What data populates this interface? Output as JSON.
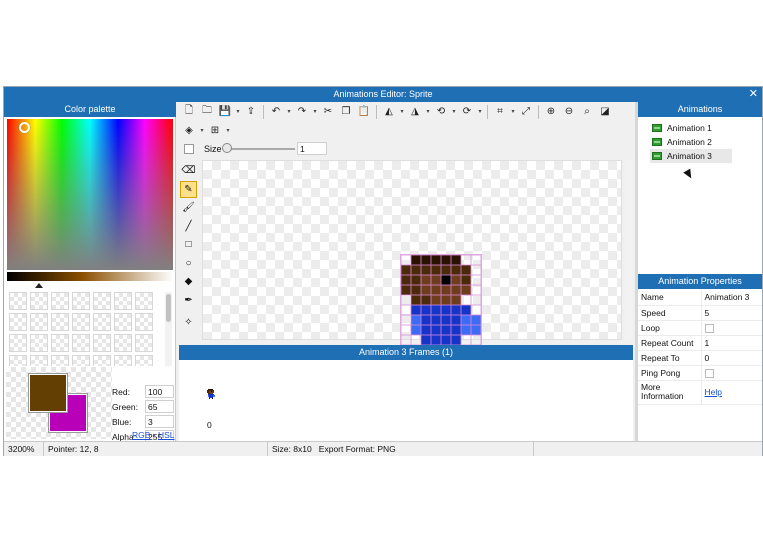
{
  "window": {
    "title": "Animations Editor: Sprite",
    "close_glyph": "✕"
  },
  "palette": {
    "header": "Color palette",
    "swatch_count": 28,
    "primary_color": "#643f03",
    "secondary_color": "#b800b8",
    "fields": [
      {
        "label": "Red:",
        "value": "100"
      },
      {
        "label": "Green:",
        "value": "65"
      },
      {
        "label": "Blue:",
        "value": "3"
      },
      {
        "label": "Alpha:",
        "value": "255"
      }
    ],
    "mode_rgb": "RGB",
    "mode_sep": " - ",
    "mode_hsl": "HSL"
  },
  "toolbar": {
    "row1": [
      {
        "name": "new-file-icon",
        "glyph": "🗋"
      },
      {
        "name": "open-folder-icon",
        "glyph": "🗀"
      },
      {
        "name": "save-icon",
        "glyph": "💾"
      },
      {
        "name": "save-dropdown-icon",
        "glyph": "▾",
        "small": true
      },
      {
        "name": "export-icon",
        "glyph": "⇪"
      },
      {
        "sep": true
      },
      {
        "name": "undo-icon",
        "glyph": "↶"
      },
      {
        "name": "undo-dropdown-icon",
        "glyph": "▾",
        "small": true
      },
      {
        "name": "redo-icon",
        "glyph": "↷"
      },
      {
        "name": "redo-dropdown-icon",
        "glyph": "▾",
        "small": true
      },
      {
        "name": "cut-icon",
        "glyph": "✂"
      },
      {
        "name": "copy-icon",
        "glyph": "❐"
      },
      {
        "name": "paste-icon",
        "glyph": "📋"
      },
      {
        "sep": true
      },
      {
        "name": "flip-horizontal-icon",
        "glyph": "◭"
      },
      {
        "name": "flip-h-dropdown-icon",
        "glyph": "▾",
        "small": true
      },
      {
        "name": "flip-vertical-icon",
        "glyph": "◮"
      },
      {
        "name": "flip-v-dropdown-icon",
        "glyph": "▾",
        "small": true
      },
      {
        "name": "rotate-left-icon",
        "glyph": "⟲"
      },
      {
        "name": "rotate-left-dropdown-icon",
        "glyph": "▾",
        "small": true
      },
      {
        "name": "rotate-right-icon",
        "glyph": "⟳"
      },
      {
        "name": "rotate-right-dropdown-icon",
        "glyph": "▾",
        "small": true
      },
      {
        "sep": true
      },
      {
        "name": "crop-icon",
        "glyph": "⌗"
      },
      {
        "name": "crop-dropdown-icon",
        "glyph": "▾",
        "small": true
      },
      {
        "name": "resize-icon",
        "glyph": "⤢"
      },
      {
        "sep": true
      },
      {
        "name": "zoom-in-icon",
        "glyph": "⊕"
      },
      {
        "name": "zoom-out-icon",
        "glyph": "⊖"
      },
      {
        "name": "zoom-fit-icon",
        "glyph": "⌕"
      },
      {
        "name": "actual-size-icon",
        "glyph": "◪"
      }
    ],
    "row2": [
      {
        "name": "layers-icon",
        "glyph": "◈"
      },
      {
        "name": "layers-dropdown-icon",
        "glyph": "▾",
        "small": true
      },
      {
        "name": "grid-icon",
        "glyph": "⊞"
      },
      {
        "name": "grid-dropdown-icon",
        "glyph": "▾",
        "small": true
      }
    ],
    "size_label": "Size",
    "size_value": "1",
    "size_fraction": 0.0
  },
  "tools": [
    {
      "name": "eraser-tool-icon",
      "glyph": "⌫",
      "active": false
    },
    {
      "name": "pencil-tool-icon",
      "glyph": "✎",
      "active": true
    },
    {
      "name": "brush-tool-icon",
      "glyph": "🖌",
      "active": false
    },
    {
      "name": "line-tool-icon",
      "glyph": "╱",
      "active": false
    },
    {
      "name": "rectangle-tool-icon",
      "glyph": "□",
      "active": false
    },
    {
      "name": "ellipse-tool-icon",
      "glyph": "○",
      "active": false
    },
    {
      "name": "fill-bucket-tool-icon",
      "glyph": "◆",
      "active": false
    },
    {
      "name": "eyedropper-tool-icon",
      "glyph": "✒",
      "active": false
    },
    {
      "name": "magic-wand-tool-icon",
      "glyph": "✧",
      "active": false
    }
  ],
  "sprite": {
    "palette": {
      "0": "transparent",
      "D": "#2a1200",
      "B": "#4a2a08",
      "S": "#6e3e1c",
      "K": "#000000",
      "M": "#1634c8",
      "L": "#3c6cf4"
    },
    "rows": [
      "0DDDDD00",
      "BBBBBBB0",
      "BBSSKSB0",
      "BBSSSSS0",
      "0BBSSS00",
      "0MMMMMM0",
      "0LMMMMLL",
      "0LMMMMLL",
      "00MMMM00",
      "00K00K00"
    ]
  },
  "frames": {
    "header": "Animation 3 Frames (1)",
    "items": [
      {
        "label": "0"
      }
    ]
  },
  "animations": {
    "header": "Animations",
    "items": [
      {
        "label": "Animation 1",
        "selected": false
      },
      {
        "label": "Animation 2",
        "selected": false
      },
      {
        "label": "Animation 3",
        "selected": true
      }
    ]
  },
  "properties": {
    "header": "Animation Properties",
    "rows": [
      {
        "key": "Name",
        "value": "Animation 3",
        "type": "text"
      },
      {
        "key": "Speed",
        "value": "5",
        "type": "text"
      },
      {
        "key": "Loop",
        "value": "",
        "type": "checkbox"
      },
      {
        "key": "Repeat Count",
        "value": "1",
        "type": "text"
      },
      {
        "key": "Repeat To",
        "value": "0",
        "type": "text"
      },
      {
        "key": "Ping Pong",
        "value": "",
        "type": "checkbox"
      },
      {
        "key": "More Information",
        "value": "Help",
        "type": "link"
      }
    ]
  },
  "status": {
    "zoom": "3200%",
    "pointer": "Pointer: 12, 8",
    "size": "Size: 8x10",
    "export": "Export Format: PNG"
  }
}
